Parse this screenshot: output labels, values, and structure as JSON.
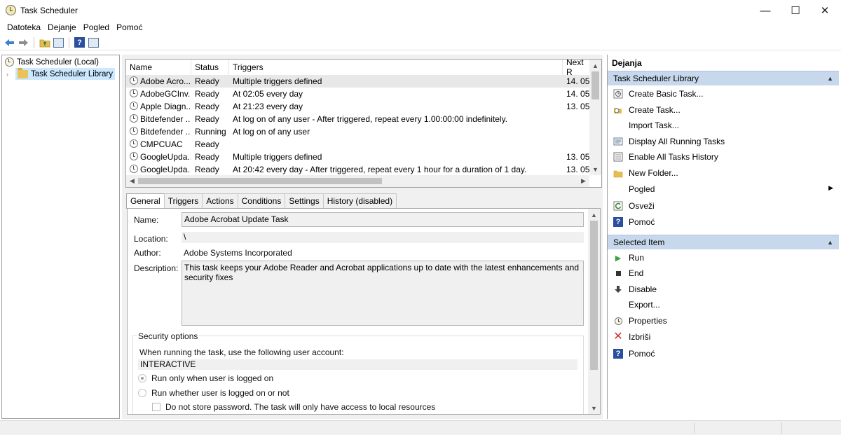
{
  "window": {
    "title": "Task Scheduler",
    "controls": {
      "minimize": "—",
      "maximize": "☐",
      "close": "✕"
    }
  },
  "menu": [
    "Datoteka",
    "Dejanje",
    "Pogled",
    "Pomoć"
  ],
  "tree": {
    "root": "Task Scheduler (Local)",
    "library": "Task Scheduler Library"
  },
  "task_list": {
    "columns": [
      "Name",
      "Status",
      "Triggers",
      "Next R"
    ],
    "rows": [
      {
        "name": "Adobe Acro...",
        "status": "Ready",
        "triggers": "Multiple triggers defined",
        "next": "14. 05."
      },
      {
        "name": "AdobeGCInv...",
        "status": "Ready",
        "triggers": "At 02:05 every day",
        "next": "14. 05."
      },
      {
        "name": "Apple Diagn...",
        "status": "Ready",
        "triggers": "At 21:23 every day",
        "next": "13. 05."
      },
      {
        "name": "Bitdefender ...",
        "status": "Ready",
        "triggers": "At log on of any user - After triggered, repeat every 1.00:00:00 indefinitely.",
        "next": ""
      },
      {
        "name": "Bitdefender ...",
        "status": "Running",
        "triggers": "At log on of any user",
        "next": ""
      },
      {
        "name": "CMPCUAC",
        "status": "Ready",
        "triggers": "",
        "next": ""
      },
      {
        "name": "GoogleUpda...",
        "status": "Ready",
        "triggers": "Multiple triggers defined",
        "next": "13. 05."
      },
      {
        "name": "GoogleUpda...",
        "status": "Ready",
        "triggers": "At 20:42 every day - After triggered, repeat every 1 hour for a duration of 1 day.",
        "next": "13. 05."
      }
    ]
  },
  "tabs": [
    "General",
    "Triggers",
    "Actions",
    "Conditions",
    "Settings",
    "History (disabled)"
  ],
  "details": {
    "name_label": "Name:",
    "name_value": "Adobe Acrobat Update Task",
    "location_label": "Location:",
    "location_value": "\\",
    "author_label": "Author:",
    "author_value": "Adobe Systems Incorporated",
    "description_label": "Description:",
    "description_value": "This task keeps your Adobe Reader and Acrobat applications up to date with the latest enhancements and security fixes",
    "security_title": "Security options",
    "account_prompt": "When running the task, use the following user account:",
    "account_value": "INTERACTIVE",
    "radio_logged_on": "Run only when user is logged on",
    "radio_whether": "Run whether user is logged on or not",
    "checkbox_no_password": "Do not store password.  The task will only have access to local resources"
  },
  "actions_pane": {
    "title": "Dejanja",
    "library_section": "Task Scheduler Library",
    "library_items": [
      {
        "label": "Create Basic Task...",
        "icon": "wand-icon"
      },
      {
        "label": "Create Task...",
        "icon": "create-task-icon"
      },
      {
        "label": "Import Task...",
        "icon": ""
      },
      {
        "label": "Display All Running Tasks",
        "icon": "running-tasks-icon"
      },
      {
        "label": "Enable All Tasks History",
        "icon": "history-icon"
      },
      {
        "label": "New Folder...",
        "icon": "folder-icon"
      },
      {
        "label": "Pogled",
        "icon": ""
      },
      {
        "label": "Osveži",
        "icon": "refresh-icon"
      },
      {
        "label": "Pomoć",
        "icon": "help-icon"
      }
    ],
    "selected_section": "Selected Item",
    "selected_items": [
      {
        "label": "Run",
        "icon": "run-icon"
      },
      {
        "label": "End",
        "icon": "end-icon"
      },
      {
        "label": "Disable",
        "icon": "disable-icon"
      },
      {
        "label": "Export...",
        "icon": ""
      },
      {
        "label": "Properties",
        "icon": "properties-icon"
      },
      {
        "label": "Izbriši",
        "icon": "delete-icon"
      },
      {
        "label": "Pomoć",
        "icon": "help-icon"
      }
    ]
  },
  "colors": {
    "section_header": "#c7d8ec",
    "selected_row": "#e8e8e8",
    "tree_selected": "#cce8ff",
    "help_blue": "#2a4f9c",
    "run_green": "#3aa53a",
    "delete_red": "#d92a2a"
  }
}
